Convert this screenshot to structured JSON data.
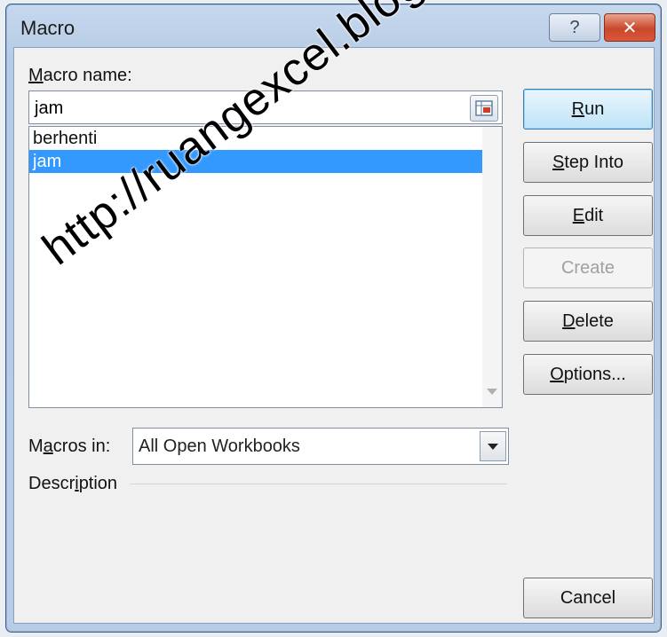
{
  "window": {
    "title": "Macro",
    "help_label": "?",
    "close_label": "✕"
  },
  "macro_name": {
    "label_first": "M",
    "label_rest": "acro name:",
    "value": "jam"
  },
  "macro_list": {
    "items": [
      "berhenti",
      "jam"
    ],
    "selected_index": 1
  },
  "buttons": {
    "run": {
      "u": "R",
      "rest": "un"
    },
    "step_into": {
      "u": "S",
      "rest": "tep Into"
    },
    "edit": {
      "u": "E",
      "rest": "dit"
    },
    "create": {
      "pre": "Cr",
      "u": "e",
      "rest": "ate"
    },
    "delete": {
      "u": "D",
      "rest": "elete"
    },
    "options": {
      "u": "O",
      "rest": "ptions..."
    },
    "cancel": "Cancel"
  },
  "macros_in": {
    "label_pre": "M",
    "label_u": "a",
    "label_rest": "cros in:",
    "value": "All Open Workbooks"
  },
  "description": {
    "label_pre": "Descr",
    "label_u": "i",
    "label_rest": "ption"
  },
  "watermark": "http://ruangexcel.blogspot.com",
  "colors": {
    "selection": "#3399ff",
    "title_bar": "#c6d8ee",
    "close_button": "#c9472a"
  }
}
